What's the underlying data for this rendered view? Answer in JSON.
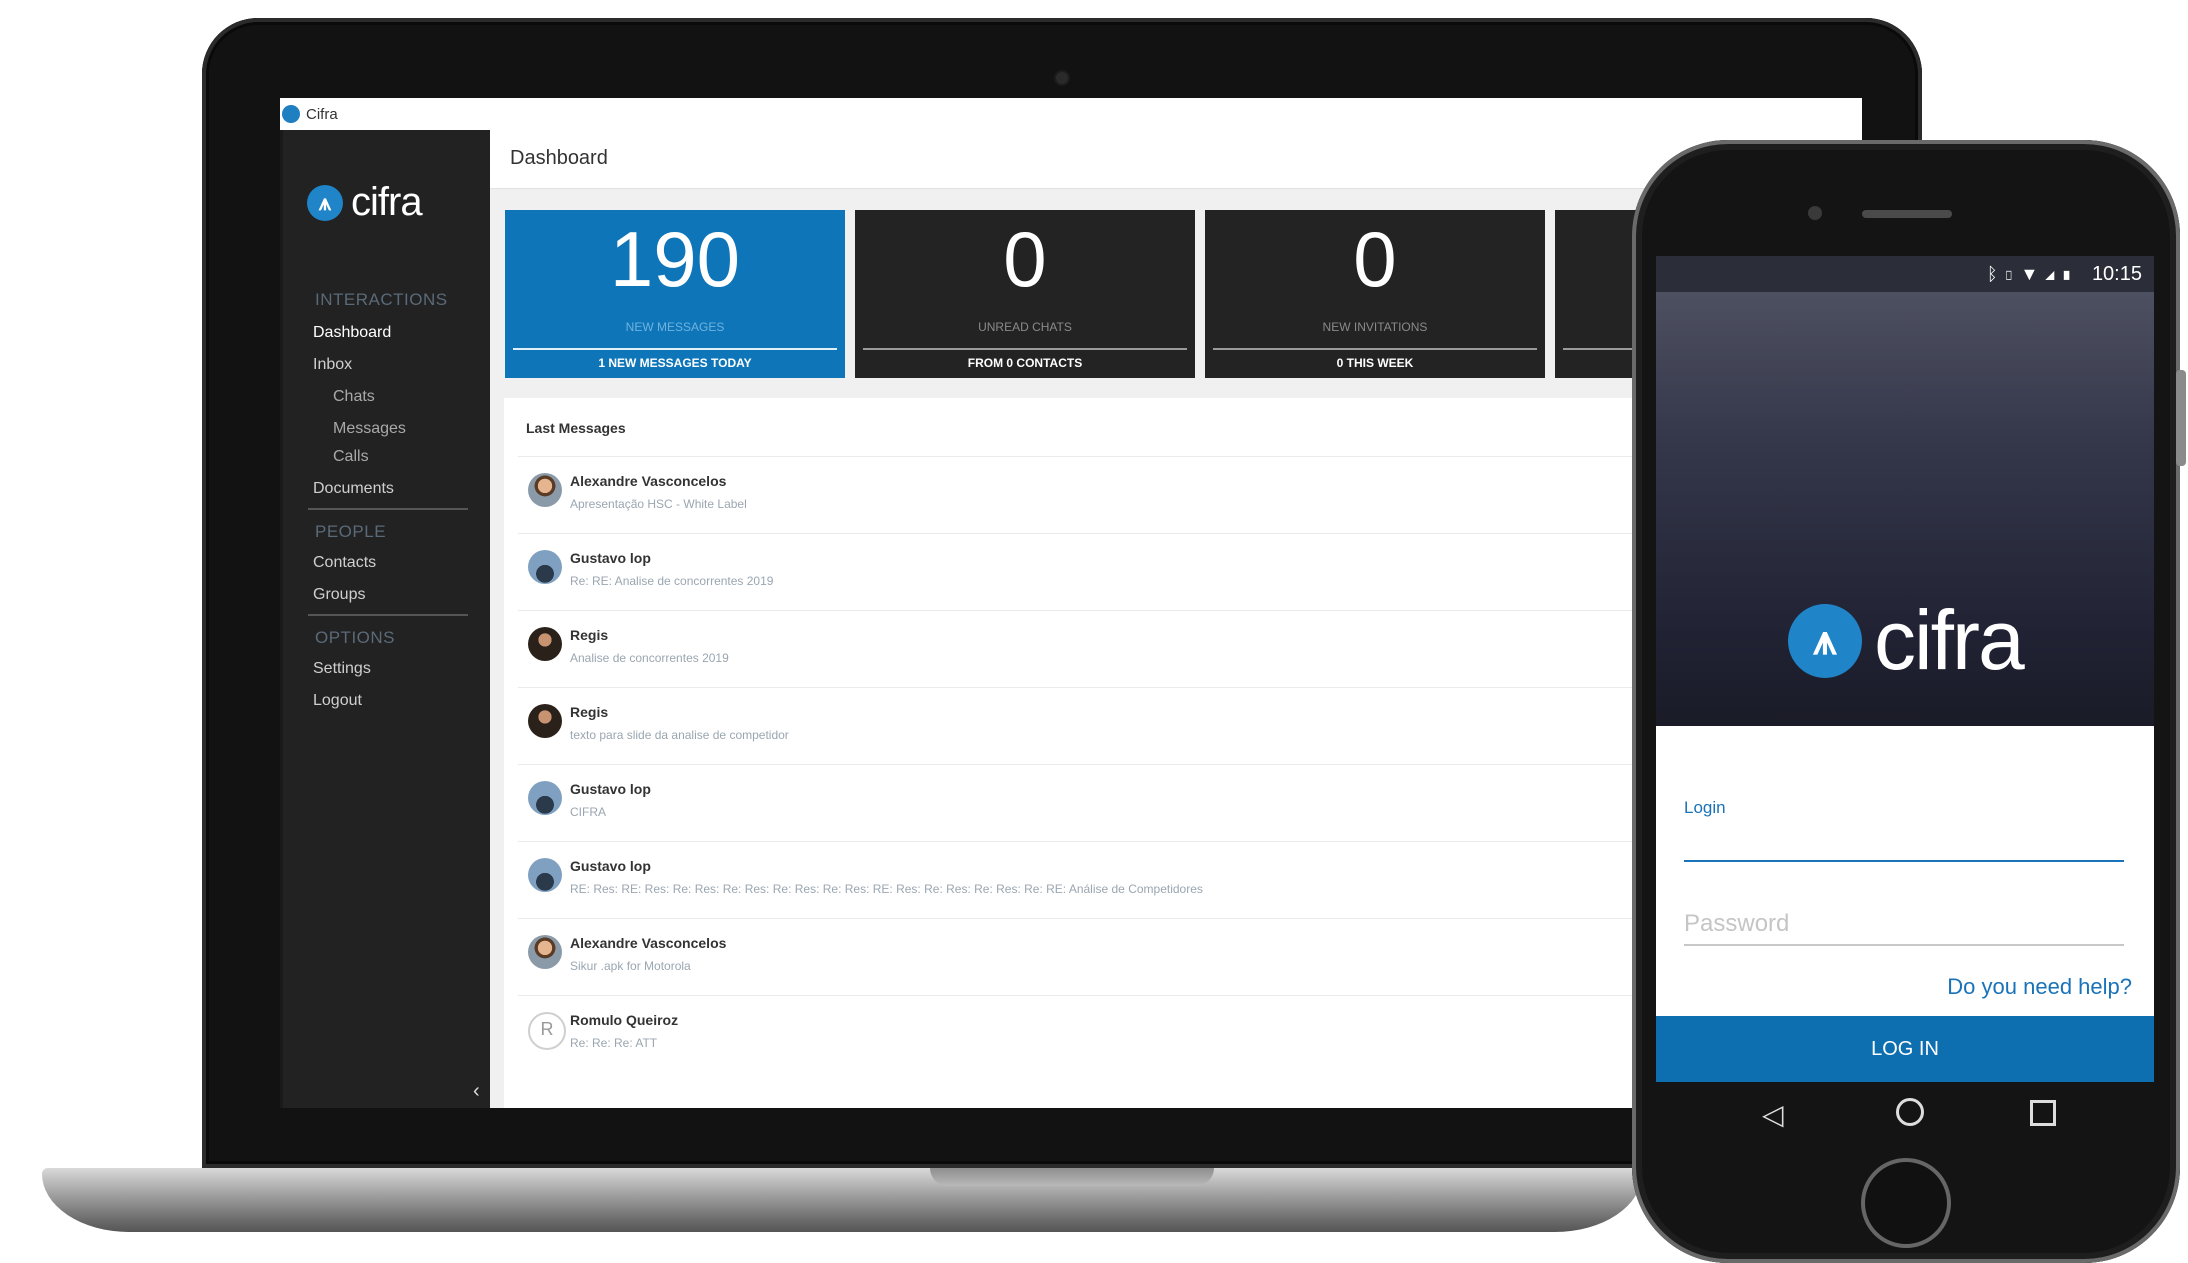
{
  "window": {
    "title": "Cifra"
  },
  "sidebar": {
    "brand": "cifra",
    "sections": {
      "interactions": "INTERACTIONS",
      "people": "PEOPLE",
      "options": "OPTIONS"
    },
    "items": {
      "dashboard": "Dashboard",
      "inbox": "Inbox",
      "chats": "Chats",
      "messages": "Messages",
      "calls": "Calls",
      "documents": "Documents",
      "contacts": "Contacts",
      "groups": "Groups",
      "settings": "Settings",
      "logout": "Logout"
    },
    "collapse_icon": "chevron-left-icon"
  },
  "main": {
    "title": "Dashboard",
    "cards": [
      {
        "number": "190",
        "label": "NEW MESSAGES",
        "footer": "1 NEW MESSAGES TODAY"
      },
      {
        "number": "0",
        "label": "UNREAD CHATS",
        "footer": "FROM 0 CONTACTS"
      },
      {
        "number": "0",
        "label": "NEW INVITATIONS",
        "footer": "0 THIS WEEK"
      }
    ],
    "last_messages": {
      "title": "Last Messages",
      "items": [
        {
          "name": "Alexandre Vasconcelos",
          "subject": "Apresentação HSC - White Label"
        },
        {
          "name": "Gustavo lop",
          "subject": "Re: RE: Analise de concorrentes 2019"
        },
        {
          "name": "Regis",
          "subject": "Analise de concorrentes 2019"
        },
        {
          "name": "Regis",
          "subject": "texto para slide da analise de competidor"
        },
        {
          "name": "Gustavo lop",
          "subject": "CIFRA"
        },
        {
          "name": "Gustavo lop",
          "subject": "RE: Res: RE: Res: Re: Res: Re: Res: Re: Res: Re: Res: RE: Res: Re: Res: Re: Res: Re: RE: Análise de Competidores"
        },
        {
          "name": "Alexandre Vasconcelos",
          "subject": "Sikur .apk for Motorola"
        },
        {
          "name": "Romulo Queiroz",
          "subject": "Re: Re: Re: ATT",
          "initial": "R"
        }
      ]
    }
  },
  "phone": {
    "status_time": "10:15",
    "brand": "cifra",
    "login_label": "Login",
    "password_placeholder": "Password",
    "help_link": "Do you need help?",
    "login_button": "LOG IN"
  },
  "colors": {
    "accent": "#0e76b8",
    "sidebar": "#222222",
    "card_dark": "#232323"
  }
}
